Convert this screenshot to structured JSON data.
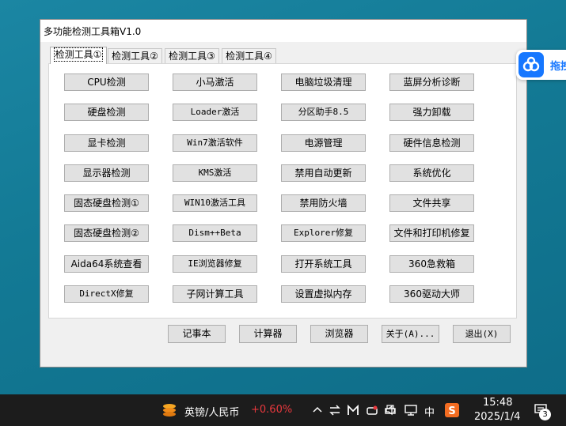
{
  "window": {
    "title": "多功能检测工具箱V1.0"
  },
  "tabs": [
    {
      "label": "检测工具①",
      "active": true
    },
    {
      "label": "检测工具②",
      "active": false
    },
    {
      "label": "检测工具③",
      "active": false
    },
    {
      "label": "检测工具④",
      "active": false
    }
  ],
  "buttons": {
    "c1": [
      "CPU检测",
      "硬盘检测",
      "显卡检测",
      "显示器检测",
      "固态硬盘检测①",
      "固态硬盘检测②",
      "Aida64系统查看",
      "DirectX修复"
    ],
    "c2": [
      "小马激活",
      "Loader激活",
      "Win7激活软件",
      "KMS激活",
      "WIN10激活工具",
      "Dism++Beta",
      "IE浏览器修复",
      "子网计算工具"
    ],
    "c3": [
      "电脑垃圾清理",
      "分区助手8.5",
      "电源管理",
      "禁用自动更新",
      "禁用防火墙",
      "Explorer修复",
      "打开系统工具",
      "设置虚拟内存"
    ],
    "c4": [
      "蓝屏分析诊断",
      "强力卸载",
      "硬件信息检测",
      "系统优化",
      "文件共享",
      "文件和打印机修复",
      "360急救箱",
      "360驱动大师"
    ]
  },
  "bottom": {
    "notepad": "记事本",
    "calculator": "计算器",
    "browser": "浏览器",
    "about": "关于(A)...",
    "exit": "退出(X)"
  },
  "float_widget": {
    "label": "拖拽",
    "icon": "baidu-netdisk-cloud-icon",
    "color": "#1677ff"
  },
  "taskbar": {
    "currency_label": "英镑/人民币",
    "currency_change": "+0.60%",
    "currency_change_color": "#e8383d",
    "tray_icons": [
      "chevron-up-icon",
      "sync-icon",
      "m-app-icon",
      "cloud-app-icon",
      "printer-icon",
      "speaker-icon",
      "display-icon"
    ],
    "ime_label": "中",
    "sogou_icon": "sogou-s-icon",
    "time": "15:48",
    "date": "2025/1/4",
    "notification_count": "3"
  }
}
